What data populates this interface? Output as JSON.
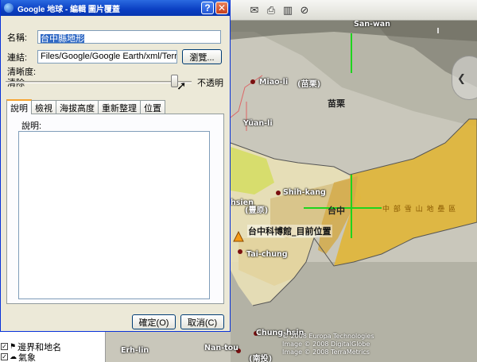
{
  "dialog": {
    "title": "Google 地球 - 編輯 圖片覆蓋",
    "help_btn": "?",
    "close_btn": "✕",
    "name_label": "名稱:",
    "name_value": "台中縣地形",
    "link_label": "連結:",
    "link_value": "Files/Google/Google Earth/xml/Terrain.jpg",
    "browse_btn": "瀏覽...",
    "clarity_label": "清晰度:",
    "clear_label": "清除",
    "opaque_label": "不透明",
    "opacity": 0.91,
    "tabs": [
      "說明",
      "檢視",
      "海拔高度",
      "重新整理",
      "位置"
    ],
    "active_tab": 0,
    "desc_label": "說明:",
    "desc_value": "",
    "ok_btn": "確定(O)",
    "cancel_btn": "取消(C)"
  },
  "toolbar": {
    "icons": [
      "mail-icon",
      "print-icon",
      "book-icon",
      "no-entry-icon"
    ]
  },
  "map": {
    "cities_en": [
      "San-wan",
      "Miao-li",
      "Yüan-li",
      "Shih-kang",
      "hsien",
      "Tai-chung",
      "Chung-hsin",
      "Erh-lin",
      "Nan-tou"
    ],
    "cities_zh": [
      "(苗栗)",
      "(豐原)",
      "(南投)"
    ],
    "county_labels": [
      "苗栗",
      "台中"
    ],
    "range_label": "中 部 雪 山 地 壘 區",
    "marker_label": "台中科博館_目前位置",
    "copyright": [
      "© 2008 Europa Technologies",
      "Image © 2008 DigitalGlobe",
      "Image © 2008 TerraMetrics"
    ]
  },
  "places": {
    "items": [
      "邊界和地名",
      "氣象"
    ]
  }
}
